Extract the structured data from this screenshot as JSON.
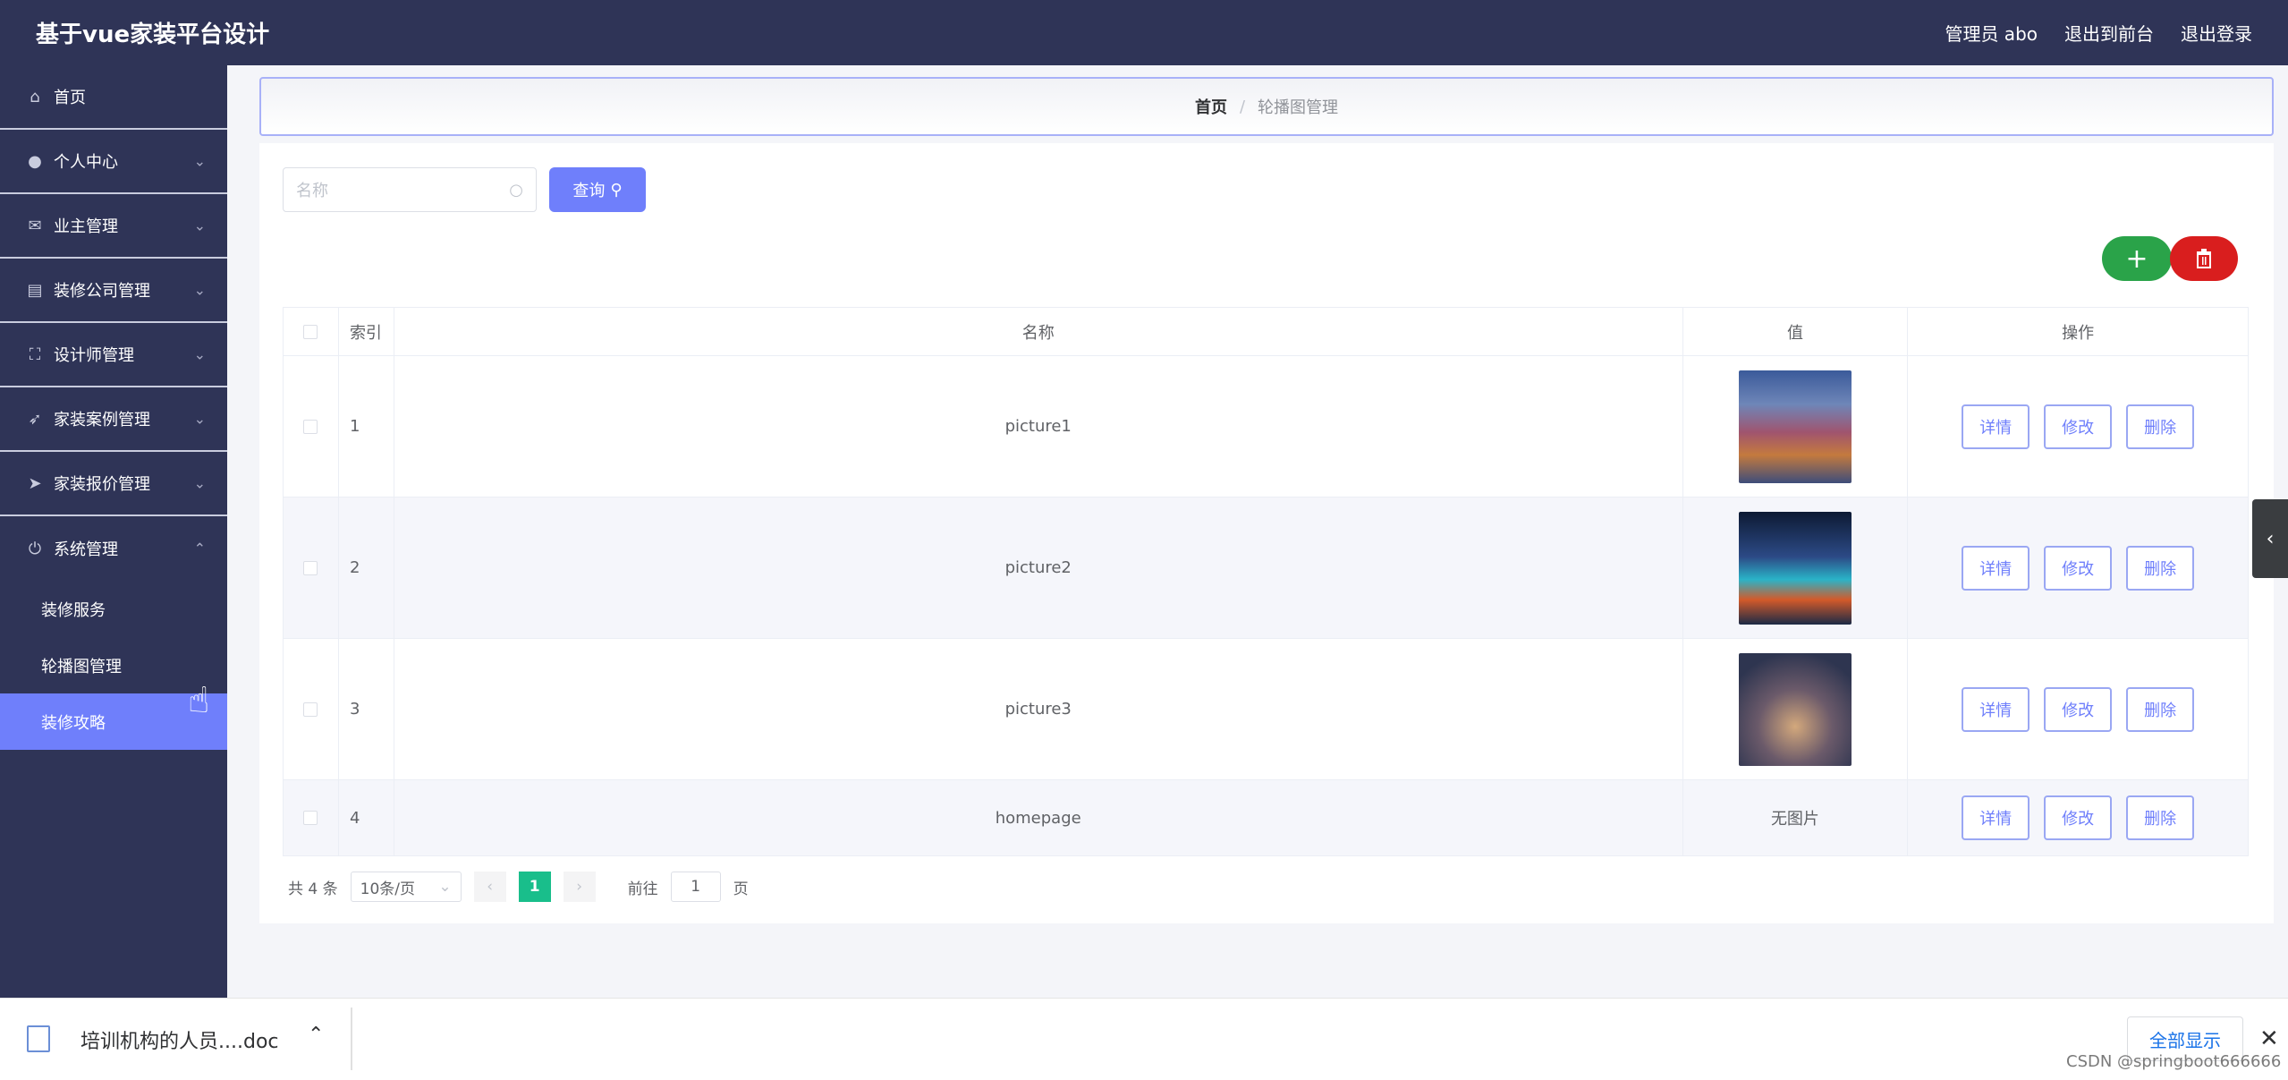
{
  "header": {
    "title": "基于vue家装平台设计",
    "user": "管理员 abo",
    "to_front": "退出到前台",
    "logout": "退出登录"
  },
  "sidebar": {
    "items": [
      {
        "label": "首页",
        "icon": "home-icon"
      },
      {
        "label": "个人中心",
        "icon": "user-icon"
      },
      {
        "label": "业主管理",
        "icon": "mail-icon"
      },
      {
        "label": "装修公司管理",
        "icon": "clipboard-icon"
      },
      {
        "label": "设计师管理",
        "icon": "frame-icon"
      },
      {
        "label": "家装案例管理",
        "icon": "send-icon"
      },
      {
        "label": "家装报价管理",
        "icon": "plane-icon"
      },
      {
        "label": "系统管理",
        "icon": "power-icon"
      }
    ],
    "sub_items": [
      {
        "label": "装修服务"
      },
      {
        "label": "轮播图管理"
      },
      {
        "label": "装修攻略"
      }
    ]
  },
  "breadcrumb": {
    "home": "首页",
    "separator": "/",
    "current": "轮播图管理"
  },
  "search": {
    "placeholder": "名称",
    "button": "查询"
  },
  "table": {
    "headers": {
      "index": "索引",
      "name": "名称",
      "value": "值",
      "ops": "操作"
    },
    "ops": {
      "detail": "详情",
      "edit": "修改",
      "delete": "删除"
    },
    "rows": [
      {
        "index": "1",
        "name": "picture1",
        "value": ""
      },
      {
        "index": "2",
        "name": "picture2",
        "value": ""
      },
      {
        "index": "3",
        "name": "picture3",
        "value": ""
      },
      {
        "index": "4",
        "name": "homepage",
        "value": "无图片"
      }
    ]
  },
  "pagination": {
    "total": "共 4 条",
    "page_size": "10条/页",
    "current_page": "1",
    "goto_label": "前往",
    "goto_value": "1",
    "page_suffix": "页"
  },
  "download_bar": {
    "file_name": "培训机构的人员....doc",
    "show_all": "全部显示"
  },
  "watermark": "CSDN @springboot666666",
  "colors": {
    "sidebar": "#2f3457",
    "accent": "#6f7ffb",
    "add": "#2aa349",
    "delete": "#d91e1e",
    "page_active": "#19be8b"
  }
}
